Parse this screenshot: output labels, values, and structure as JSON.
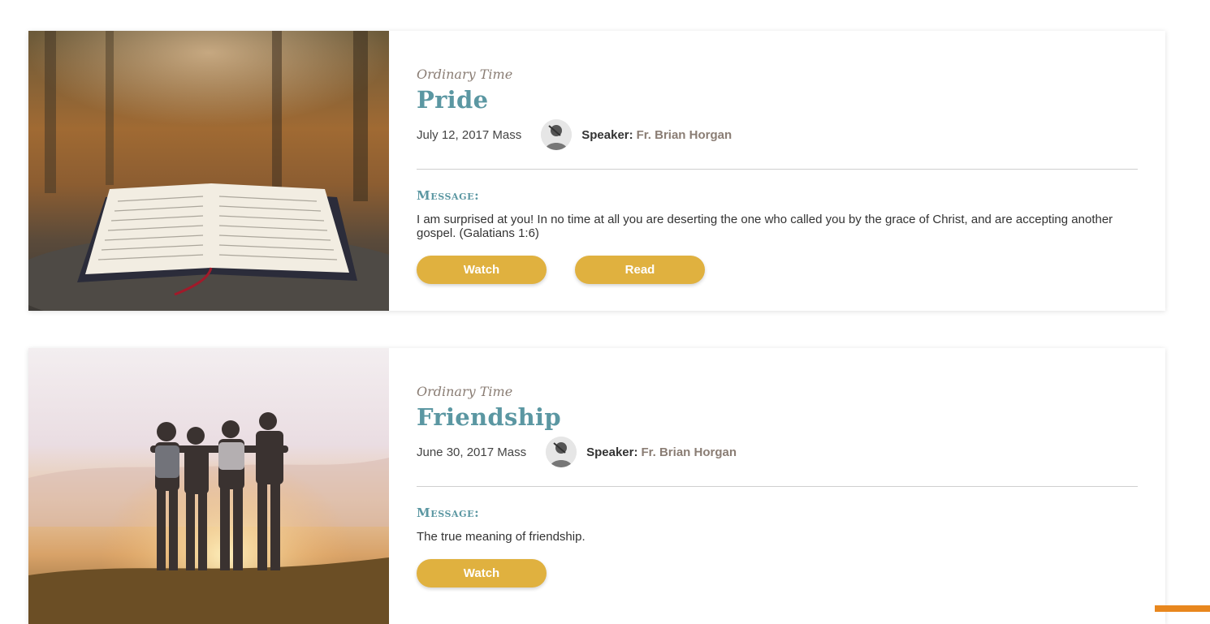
{
  "sermons": [
    {
      "season": "Ordinary Time",
      "title": "Pride",
      "date": "July 12, 2017 Mass",
      "speaker_label": "Speaker:",
      "speaker_name": "Fr. Brian Horgan",
      "message_label": "Message:",
      "message": "I am surprised at you! In no time at all you are deserting the one who called you by the grace of Christ, and are accepting another gospel. (Galatians 1:6)",
      "buttons": [
        "Watch",
        "Read"
      ],
      "image": "open-bible-photo"
    },
    {
      "season": "Ordinary Time",
      "title": "Friendship",
      "date": "June 30, 2017 Mass",
      "speaker_label": "Speaker:",
      "speaker_name": "Fr. Brian Horgan",
      "message_label": "Message:",
      "message": "The true meaning of friendship.",
      "buttons": [
        "Watch"
      ],
      "image": "friends-sunset-photo"
    }
  ],
  "colors": {
    "accent_teal": "#5b97a2",
    "button_gold": "#e0b13f",
    "muted_brown": "#8a7d74"
  }
}
